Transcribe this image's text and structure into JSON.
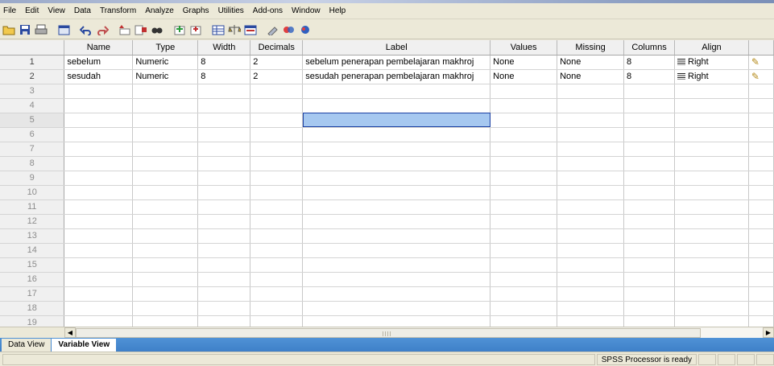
{
  "menubar": {
    "items": [
      "File",
      "Edit",
      "View",
      "Data",
      "Transform",
      "Analyze",
      "Graphs",
      "Utilities",
      "Add-ons",
      "Window",
      "Help"
    ]
  },
  "toolbar": {
    "icons": [
      "open-folder-icon",
      "save-icon",
      "print-icon",
      "dialog-recall-icon",
      "undo-icon",
      "redo-icon",
      "goto-case-icon",
      "variables-icon",
      "find-icon",
      "insert-case-icon",
      "insert-variable-icon",
      "split-file-icon",
      "weight-cases-icon",
      "select-cases-icon",
      "value-labels-icon",
      "use-sets-icon",
      "show-all-icon"
    ]
  },
  "grid": {
    "columns": [
      "Name",
      "Type",
      "Width",
      "Decimals",
      "Label",
      "Values",
      "Missing",
      "Columns",
      "Align"
    ],
    "rows": [
      {
        "num": "1",
        "name": "sebelum",
        "type": "Numeric",
        "width": "8",
        "decimals": "2",
        "label": "sebelum penerapan pembelajaran makhroj",
        "values": "None",
        "missing": "None",
        "columns": "8",
        "align": "Right"
      },
      {
        "num": "2",
        "name": "sesudah",
        "type": "Numeric",
        "width": "8",
        "decimals": "2",
        "label": "sesudah penerapan pembelajaran makhroj",
        "values": "None",
        "missing": "None",
        "columns": "8",
        "align": "Right"
      }
    ],
    "empty_row_numbers": [
      "3",
      "4",
      "5",
      "6",
      "7",
      "8",
      "9",
      "10",
      "11",
      "12",
      "13",
      "14",
      "15",
      "16",
      "17",
      "18",
      "19"
    ],
    "selected_row": "5",
    "selected_column": "Label",
    "selection_color": "#a6c8f0"
  },
  "tabs": {
    "data_view": "Data View",
    "variable_view": "Variable View",
    "active": "Variable View"
  },
  "status": {
    "processor": "SPSS  Processor is ready"
  },
  "colors": {
    "tabbar": "#4f92d6",
    "chrome": "#ece9d8"
  }
}
